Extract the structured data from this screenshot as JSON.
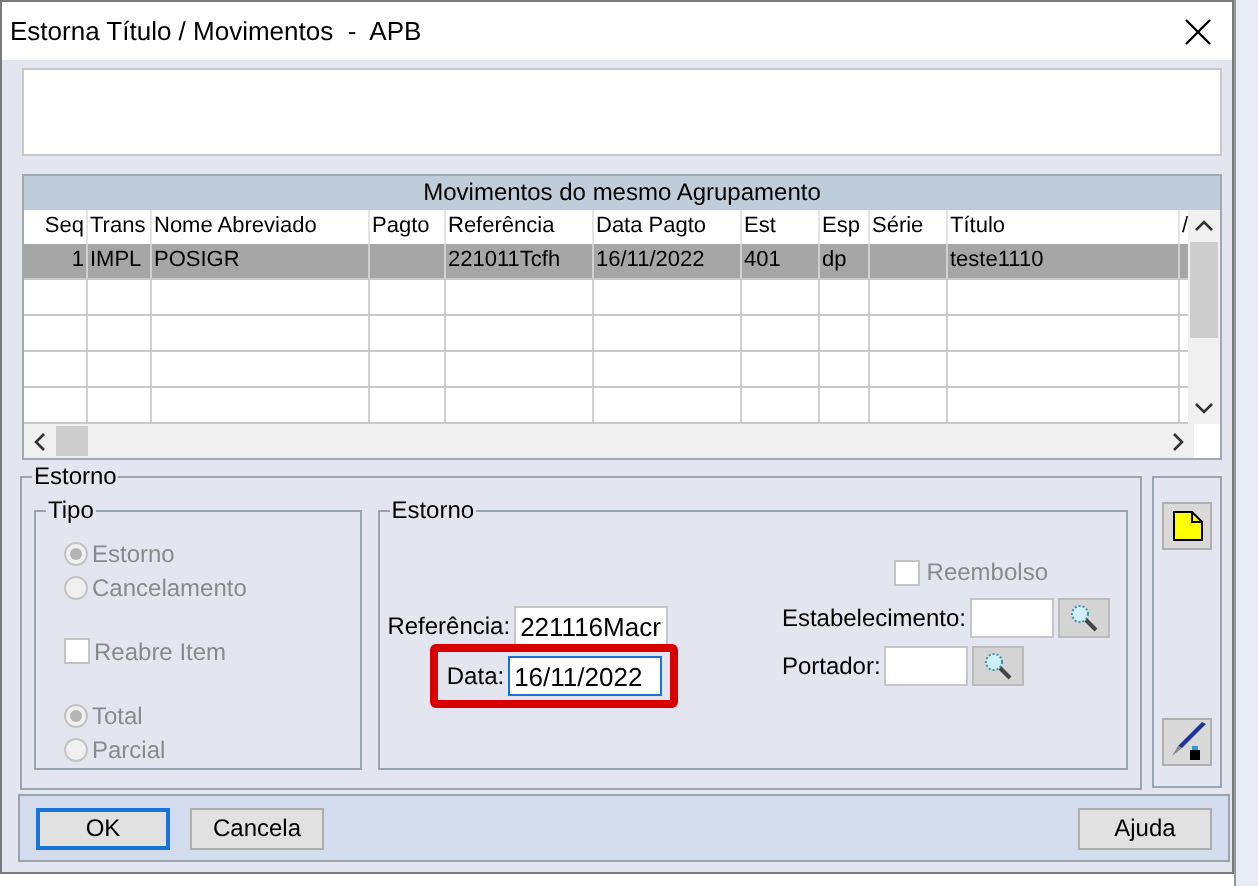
{
  "window": {
    "title": "Estorna Título / Movimentos  -  APB"
  },
  "grid": {
    "title": "Movimentos do mesmo Agrupamento",
    "columns": [
      "Seq",
      "Trans",
      "Nome Abreviado",
      "Pagto",
      "Referência",
      "Data Pagto",
      "Est",
      "Esp",
      "Série",
      "Título",
      "/"
    ],
    "rows": [
      {
        "selected": true,
        "cells": [
          "1",
          "IMPL",
          "POSIGR",
          "",
          "221011Tcfh",
          "16/11/2022",
          "401",
          "dp",
          "",
          "teste1110",
          ""
        ]
      },
      {
        "selected": false,
        "cells": [
          "",
          "",
          "",
          "",
          "",
          "",
          "",
          "",
          "",
          "",
          ""
        ]
      },
      {
        "selected": false,
        "cells": [
          "",
          "",
          "",
          "",
          "",
          "",
          "",
          "",
          "",
          "",
          ""
        ]
      },
      {
        "selected": false,
        "cells": [
          "",
          "",
          "",
          "",
          "",
          "",
          "",
          "",
          "",
          "",
          ""
        ]
      },
      {
        "selected": false,
        "cells": [
          "",
          "",
          "",
          "",
          "",
          "",
          "",
          "",
          "",
          "",
          ""
        ]
      }
    ]
  },
  "estorno_group": {
    "title": "Estorno",
    "tipo": {
      "title": "Tipo",
      "items": [
        {
          "kind": "radio",
          "label": "Estorno",
          "selected": true,
          "disabled": true
        },
        {
          "kind": "radio",
          "label": "Cancelamento",
          "selected": false,
          "disabled": true
        },
        {
          "kind": "gap"
        },
        {
          "kind": "checkbox",
          "label": "Reabre Item",
          "checked": false,
          "disabled": true
        },
        {
          "kind": "gap"
        },
        {
          "kind": "radio",
          "label": "Total",
          "selected": true,
          "disabled": true
        },
        {
          "kind": "radio",
          "label": "Parcial",
          "selected": false,
          "disabled": true
        }
      ]
    },
    "detail": {
      "title": "Estorno",
      "reembolso": {
        "label": "Reembolso",
        "checked": false,
        "disabled": true
      },
      "referencia": {
        "label": "Referência:",
        "value": "221116Macr"
      },
      "data": {
        "label": "Data:",
        "value": "16/11/2022",
        "focused": true,
        "highlighted": true
      },
      "estabelecimento": {
        "label": "Estabelecimento:"
      },
      "portador": {
        "label": "Portador:"
      }
    }
  },
  "buttons": [
    {
      "label": "OK",
      "default": true
    },
    {
      "label": "Cancela",
      "default": false
    },
    {
      "label": "Ajuda",
      "default": false
    }
  ]
}
